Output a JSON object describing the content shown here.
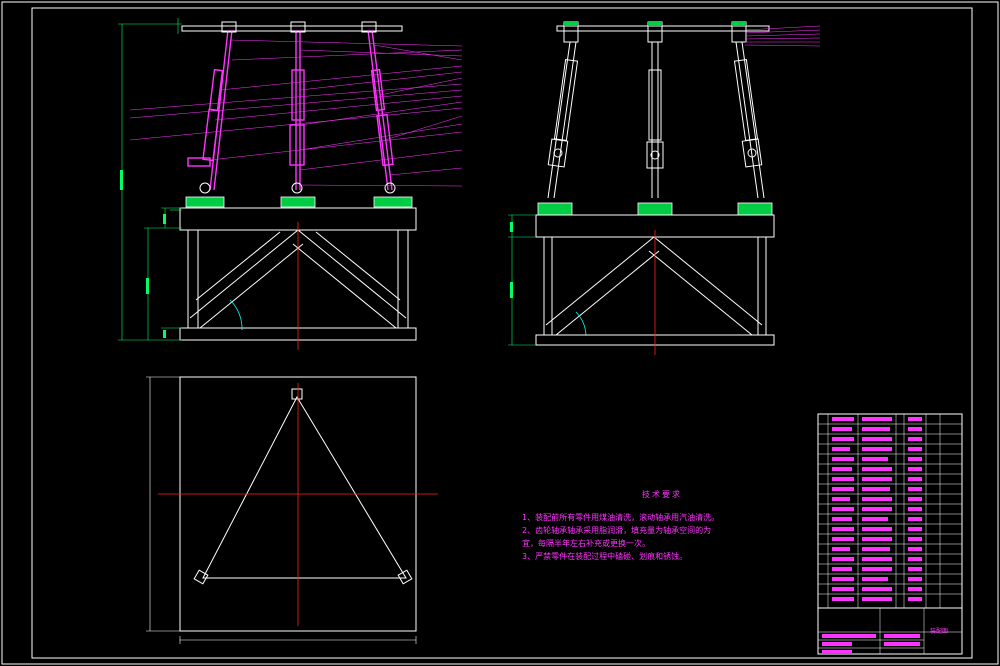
{
  "drawing": {
    "background_color": "#000000",
    "line_color": "#ffffff",
    "part_color": "#ff33ff",
    "leader_color": "#ff33ff",
    "center_line_color": "#ff2020",
    "dimension_color": "#00ff66",
    "base_fill_color": "#00cc44",
    "angle_arc_color": "#00ffff"
  },
  "tech_notes": {
    "title": "技术要求",
    "items": [
      "1、装配前所有零件用煤油清洗，滚动轴承用汽油清洗。",
      "2、齿轮轴承轴承采用脂润滑，填充量为轴承空间的为",
      "宜，每隔半年左右补充或更换一次。",
      "3、严禁零件在装配过程中磕碰、划痕和锈蚀。"
    ]
  },
  "title_block": {
    "drawing_name": "装配图"
  }
}
